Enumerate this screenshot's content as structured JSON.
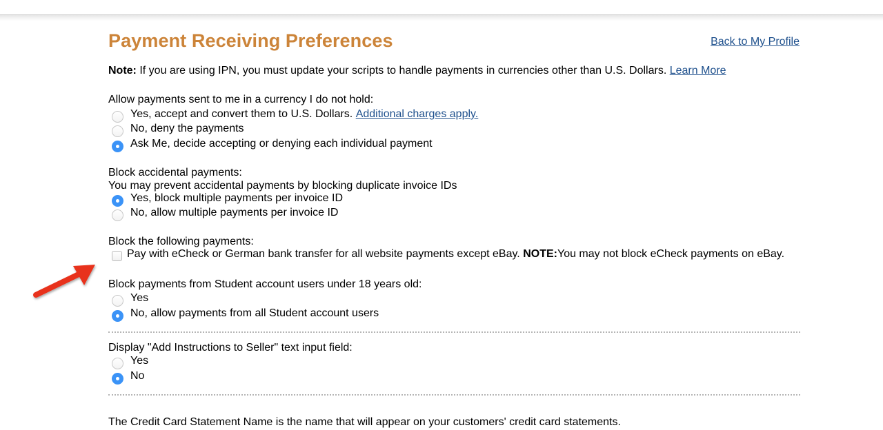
{
  "page": {
    "title": "Payment Receiving Preferences",
    "back_link": "Back to My Profile"
  },
  "note": {
    "label": "Note:",
    "text": " If you are using IPN, you must update your scripts to handle payments in currencies other than U.S. Dollars. ",
    "link": "Learn More"
  },
  "currency": {
    "question": "Allow payments sent to me in a currency I do not hold:",
    "options": [
      {
        "label": "Yes, accept and convert them to U.S. Dollars. ",
        "link": "Additional charges apply.",
        "checked": false
      },
      {
        "label": "No, deny the payments",
        "checked": false
      },
      {
        "label": "Ask Me, decide accepting or denying each individual payment",
        "checked": true
      }
    ]
  },
  "accidental": {
    "question": "Block accidental payments:",
    "description": "You may prevent accidental payments by blocking duplicate invoice IDs",
    "options": [
      {
        "label": "Yes, block multiple payments per invoice ID",
        "checked": true
      },
      {
        "label": "No, allow multiple payments per invoice ID",
        "checked": false
      }
    ]
  },
  "block_following": {
    "question": "Block the following payments:",
    "checkbox_label": "Pay with eCheck or German bank transfer for all website payments except eBay. ",
    "note_label": "NOTE:",
    "note_text": " You may not block eCheck payments on eBay.",
    "checked": false
  },
  "student": {
    "question": "Block payments from Student account users under 18 years old:",
    "options": [
      {
        "label": "Yes",
        "checked": false
      },
      {
        "label": "No, allow payments from all Student account users",
        "checked": true
      }
    ]
  },
  "instructions": {
    "question": "Display \"Add Instructions to Seller\" text input field:",
    "options": [
      {
        "label": "Yes",
        "checked": false
      },
      {
        "label": "No",
        "checked": true
      }
    ]
  },
  "credit_card": {
    "text": "The Credit Card Statement Name is the name that will appear on your customers' credit card statements."
  },
  "colors": {
    "title": "#cc8439",
    "link": "#1d4f8c",
    "radio_checked": "#3b93f7",
    "annotation_arrow": "#e8321c"
  }
}
